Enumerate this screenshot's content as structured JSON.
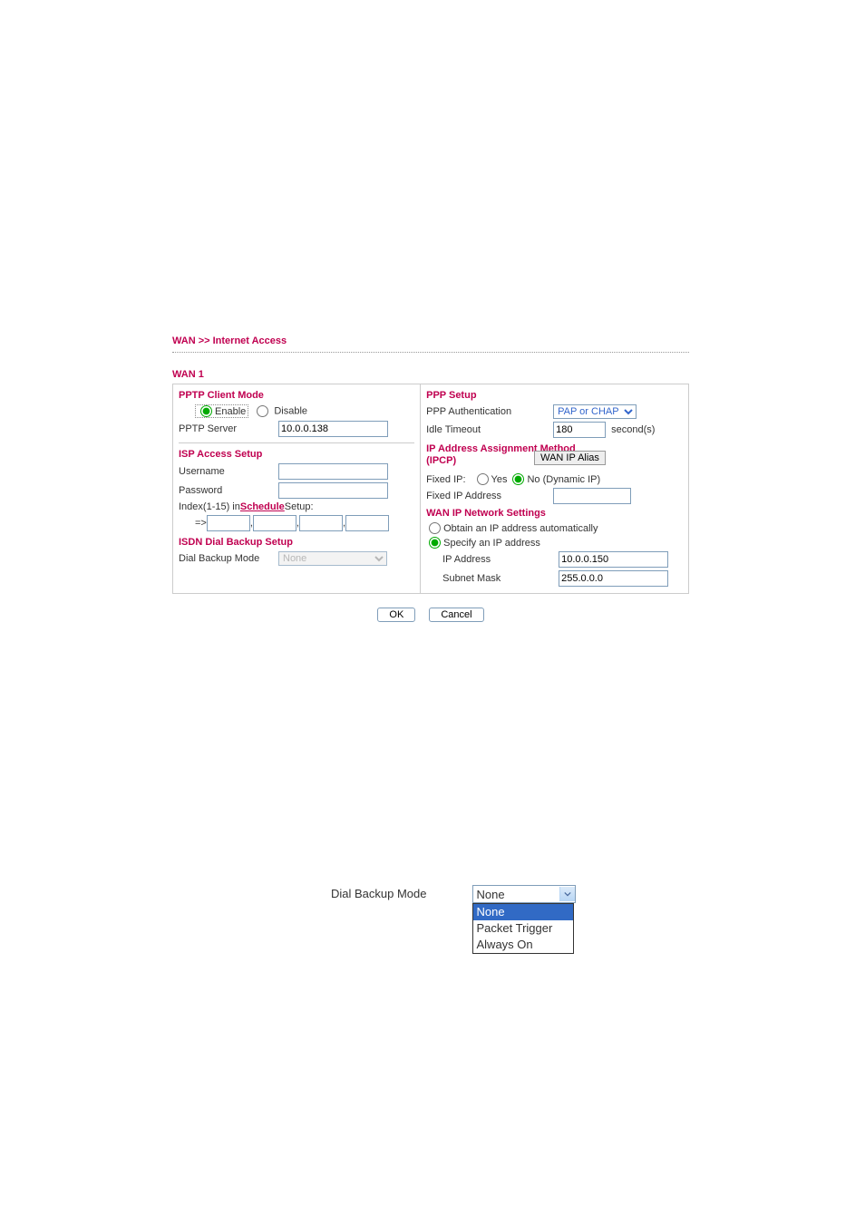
{
  "breadcrumb": "WAN >> Internet Access",
  "wan_title": "WAN 1",
  "left": {
    "pptp_client_mode": "PPTP Client Mode",
    "enable": "Enable",
    "disable": "Disable",
    "pptp_server_label": "PPTP Server",
    "pptp_server_value": "10.0.0.138",
    "isp_access_setup": "ISP Access Setup",
    "username_label": "Username",
    "username_value": "",
    "password_label": "Password",
    "password_value": "",
    "index_prefix": "Index(1-15) in ",
    "schedule_link": "Schedule",
    "index_suffix": " Setup:",
    "arrow": "=>",
    "sched1": "",
    "sched2": "",
    "sched3": "",
    "sched4": "",
    "isdn_title": "ISDN Dial Backup Setup",
    "dial_backup_label": "Dial Backup Mode",
    "dial_backup_value": "None"
  },
  "right": {
    "ppp_setup": "PPP Setup",
    "ppp_auth_label": "PPP Authentication",
    "ppp_auth_value": "PAP or CHAP",
    "idle_timeout_label": "Idle Timeout",
    "idle_timeout_value": "180",
    "seconds": "second(s)",
    "ip_assign_title": "IP Address Assignment Method (IPCP)",
    "wan_ip_alias": "WAN IP Alias",
    "fixed_ip_label": "Fixed IP:",
    "yes": "Yes",
    "no_dyn": "No (Dynamic IP)",
    "fixed_ip_addr_label": "Fixed IP Address",
    "fixed_ip_addr_value": "",
    "wan_net_title": "WAN IP Network Settings",
    "obtain_auto": "Obtain an IP address automatically",
    "specify": "Specify an IP address",
    "ip_address_label": "IP Address",
    "ip_address_value": "10.0.0.150",
    "subnet_label": "Subnet Mask",
    "subnet_value": "255.0.0.0"
  },
  "buttons": {
    "ok": "OK",
    "cancel": "Cancel"
  },
  "figure2": {
    "label": "Dial Backup Mode",
    "selected": "None",
    "options": [
      "None",
      "Packet Trigger",
      "Always On"
    ]
  }
}
